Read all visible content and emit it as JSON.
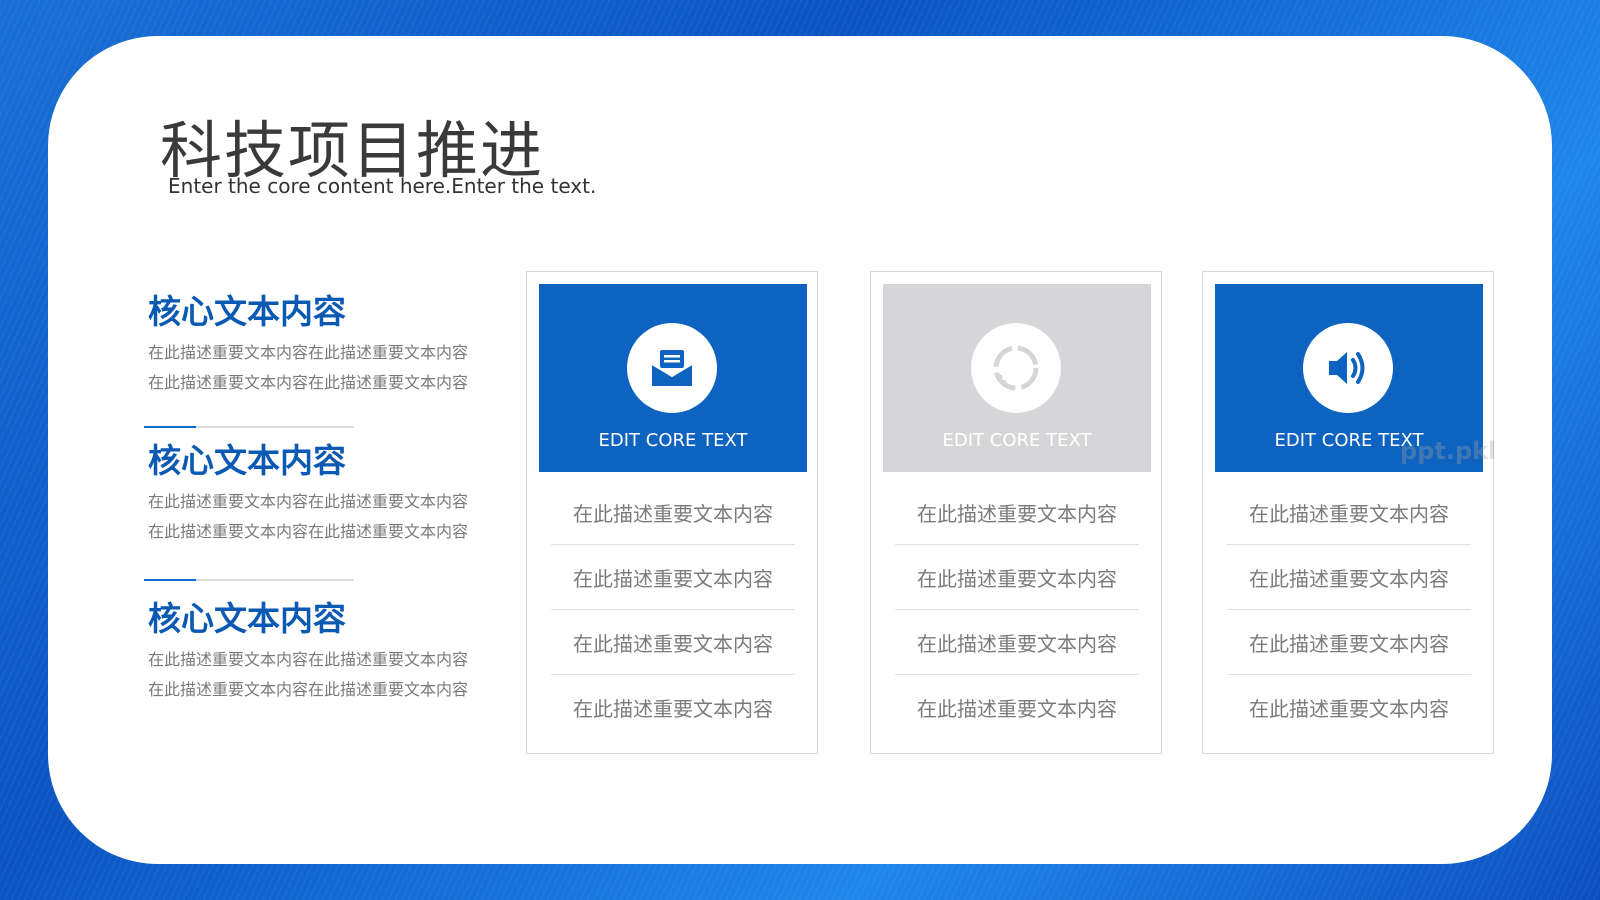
{
  "slide": {
    "title": "科技项目推进",
    "subtitle": "Enter the core content here.Enter the text."
  },
  "left_items": [
    {
      "heading": "核心文本内容",
      "line1": "在此描述重要文本内容在此描述重要文本内容",
      "line2": "在此描述重要文本内容在此描述重要文本内容"
    },
    {
      "heading": "核心文本内容",
      "line1": "在此描述重要文本内容在此描述重要文本内容",
      "line2": "在此描述重要文本内容在此描述重要文本内容"
    },
    {
      "heading": "核心文本内容",
      "line1": "在此描述重要文本内容在此描述重要文本内容",
      "line2": "在此描述重要文本内容在此描述重要文本内容"
    }
  ],
  "columns": [
    {
      "icon": "envelope-icon",
      "label": "EDIT CORE TEXT",
      "header_color": "#0d63bf",
      "rows": [
        "在此描述重要文本内容",
        "在此描述重要文本内容",
        "在此描述重要文本内容",
        "在此描述重要文本内容"
      ]
    },
    {
      "icon": "refresh-circle-icon",
      "label": "EDIT CORE TEXT",
      "header_color": "#d6d6d8",
      "rows": [
        "在此描述重要文本内容",
        "在此描述重要文本内容",
        "在此描述重要文本内容",
        "在此描述重要文本内容"
      ]
    },
    {
      "icon": "speaker-icon",
      "label": "EDIT CORE TEXT",
      "header_color": "#0d63bf",
      "rows": [
        "在此描述重要文本内容",
        "在此描述重要文本内容",
        "在此描述重要文本内容",
        "在此描述重要文本内容"
      ]
    }
  ],
  "watermark": "ppt.pkl",
  "colors": {
    "accent": "#0d63bf",
    "heading": "#0a59b3",
    "gray_header": "#d6d6d8"
  }
}
